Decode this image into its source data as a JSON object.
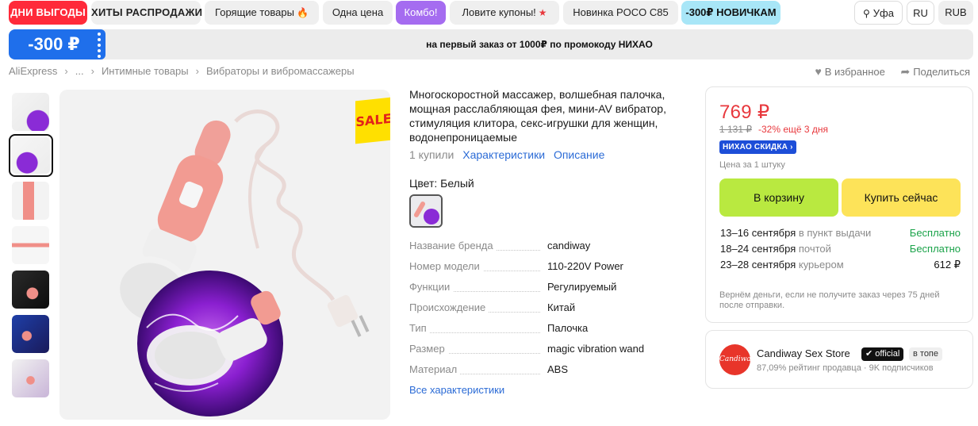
{
  "nav": {
    "chips": [
      {
        "label": "ДНИ ВЫГОДЫ",
        "style": "red"
      },
      {
        "label": "ХИТЫ РАСПРОДАЖИ",
        "style": "bold"
      },
      {
        "label": "Горящие товары",
        "style": "plain",
        "icon": "fire-icon",
        "glyph": "🔥"
      },
      {
        "label": "Одна цена",
        "style": "plain"
      },
      {
        "label": "Комбо!",
        "style": "purple"
      },
      {
        "label": "Ловите купоны!",
        "style": "plain",
        "icon": "star-icon",
        "glyph": "★"
      },
      {
        "label": "Новинка POCO C85",
        "style": "plain"
      },
      {
        "label": "-300₽ НОВИЧКАМ",
        "style": "cyan"
      }
    ],
    "location": "Уфа",
    "language": "RU",
    "currency": "RUB"
  },
  "promo": {
    "amount": "-300 ₽",
    "text": "на первый заказ от 1000₽ по промокоду НИХАО"
  },
  "breadcrumb": [
    "AliExpress",
    "...",
    "Интимные товары",
    "Вибраторы и вибромассажеры"
  ],
  "actions": {
    "favorite": "В избранное",
    "share": "Поделиться"
  },
  "gallery": {
    "sale_label": "SALE"
  },
  "product": {
    "title": "Многоскоростной массажер, волшебная палочка, мощная расслабляющая фея, мини-AV вибратор, стимуляция клитора, секс-игрушки для женщин, водонепроницаемые",
    "bought": "1 купили",
    "specs_link": "Характеристики",
    "description_link": "Описание",
    "color_label": "Цвет: Белый",
    "specs": [
      {
        "key": "Название бренда",
        "value": "candiway"
      },
      {
        "key": "Номер модели",
        "value": "110-220V Power"
      },
      {
        "key": "Функции",
        "value": "Регулируемый"
      },
      {
        "key": "Происхождение",
        "value": "Китай"
      },
      {
        "key": "Тип",
        "value": "Палочка"
      },
      {
        "key": "Размер",
        "value": "magic vibration wand"
      },
      {
        "key": "Материал",
        "value": "ABS"
      }
    ],
    "all_specs": "Все характеристики"
  },
  "price": {
    "current": "769 ₽",
    "old": "1 131 ₽",
    "discount": "-32% ещё 3 дня",
    "badge": "НИХАО СКИДКА",
    "unit": "Цена за 1 штуку",
    "cart_button": "В корзину",
    "buy_button": "Купить сейчас",
    "delivery": [
      {
        "dates": "13–16 сентября",
        "method": "в пункт выдачи",
        "cost": "Бесплатно",
        "free": true
      },
      {
        "dates": "18–24 сентября",
        "method": "почтой",
        "cost": "Бесплатно",
        "free": true
      },
      {
        "dates": "23–28 сентября",
        "method": "курьером",
        "cost": "612 ₽",
        "free": false
      }
    ],
    "refund": "Вернём деньги, если не получите заказ через 75 дней после отправки."
  },
  "seller": {
    "logo_text": "Candiway",
    "name": "Candiway Sex Store",
    "official": "official",
    "top": "в топе",
    "rating": "87,09% рейтинг продавца",
    "subscribers": "9K подписчиков"
  },
  "colors": {
    "accent_red": "#ff2a3a",
    "price_red": "#e8383d",
    "promo_blue": "#1f6feb",
    "cart_green": "#b9e940",
    "buy_yellow": "#fde359",
    "link_blue": "#2b6bd6",
    "free_green": "#1ba34a"
  }
}
